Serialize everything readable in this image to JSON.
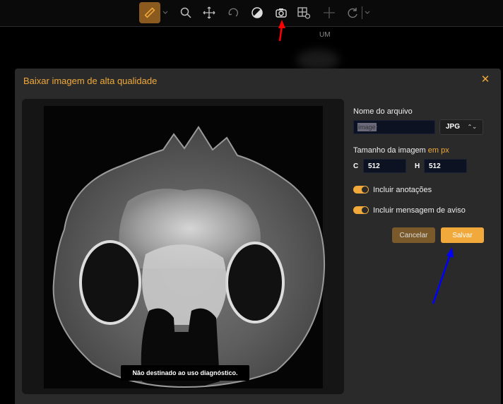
{
  "viewport": {
    "label": "UM"
  },
  "toolbar": {
    "tools": [
      {
        "name": "measure-ruler-icon",
        "active": true
      },
      {
        "name": "zoom-icon"
      },
      {
        "name": "pan-icon"
      },
      {
        "name": "rotate-icon"
      },
      {
        "name": "contrast-icon"
      },
      {
        "name": "camera-icon"
      },
      {
        "name": "layout-icon"
      },
      {
        "name": "crosshair-icon"
      },
      {
        "name": "reset-icon"
      }
    ]
  },
  "dialog": {
    "title": "Baixar imagem de alta qualidade",
    "close_icon": "close-icon",
    "warning": "Não destinado ao uso diagnóstico.",
    "file_name_label": "Nome do arquivo",
    "file_name_placeholder": "image",
    "format_value": "JPG",
    "size_label": "Tamanho da imagem",
    "size_unit": "em px",
    "width_letter": "C",
    "width_value": "512",
    "height_letter": "H",
    "height_value": "512",
    "annotations_label": "Incluir anotações",
    "annotations_on": true,
    "warning_msg_label": "Incluir mensagem de aviso",
    "warning_msg_on": true,
    "cancel_label": "Cancelar",
    "save_label": "Salvar"
  },
  "colors": {
    "accent": "#f0a93a",
    "dialog_bg": "#2a2a2a",
    "annotation_red_arrow": "#ff0000",
    "annotation_blue_arrow": "#0000ff"
  }
}
